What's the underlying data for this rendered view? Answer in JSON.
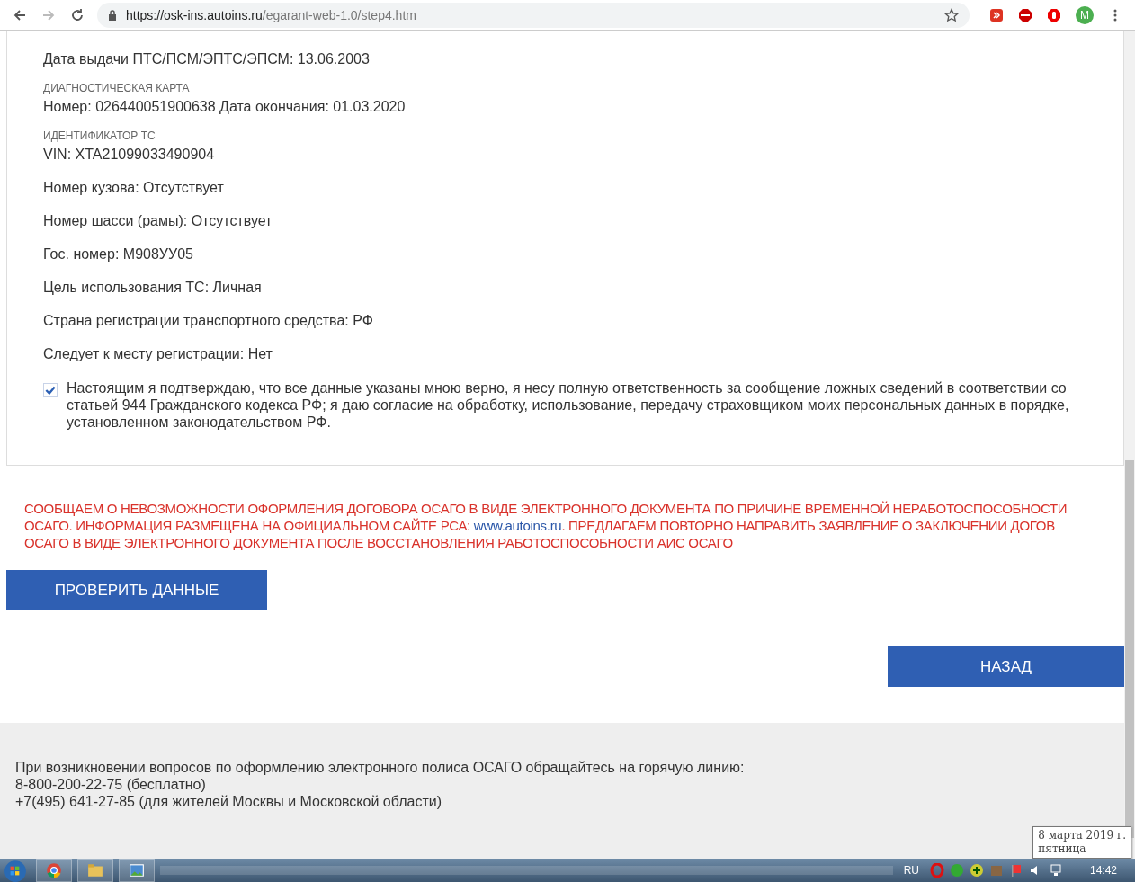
{
  "browser": {
    "url_host": "https://osk-ins.autoins.ru",
    "url_path": "/egarant-web-1.0/step4.htm",
    "profile_initial": "M"
  },
  "fields": [
    {
      "kind": "row",
      "text": "Дата выдачи ПТС/ПСМ/ЭПТС/ЭПСМ: 13.06.2003"
    },
    {
      "kind": "caption",
      "text": "ДИАГНОСТИЧЕСКАЯ КАРТА"
    },
    {
      "kind": "row",
      "text": "Номер: 026440051900638 Дата окончания: 01.03.2020"
    },
    {
      "kind": "caption",
      "text": "ИДЕНТИФИКАТОР ТС"
    },
    {
      "kind": "row",
      "text": "VIN: XTA21099033490904"
    },
    {
      "kind": "row",
      "text": "Номер кузова: Отсутствует"
    },
    {
      "kind": "row",
      "text": "Номер шасси (рамы): Отсутствует"
    },
    {
      "kind": "row",
      "text": "Гос. номер: М908УУ05"
    },
    {
      "kind": "row",
      "text": "Цель использования ТС: Личная"
    },
    {
      "kind": "row",
      "text": "Страна регистрации транспортного средства: РФ"
    },
    {
      "kind": "row",
      "text": "Следует к месту регистрации: Нет"
    }
  ],
  "consent": {
    "checked": true,
    "text": "Настоящим я подтверждаю, что все данные указаны мною верно, я несу полную ответственность за сообщение ложных сведений в соответствии со статьей 944 Гражданского кодекса РФ; я даю согласие на обработку, использование, передачу страховщиком моих персональных данных в порядке, установленном законодательством РФ."
  },
  "notice": {
    "before_link": "СООБЩАЕМ О НЕВОЗМОЖНОСТИ ОФОРМЛЕНИЯ ДОГОВОРА ОСАГО В ВИДЕ ЭЛЕКТРОННОГО ДОКУМЕНТА ПО ПРИЧИНЕ ВРЕМЕННОЙ НЕРАБОТОСПОСОБНОСТИ\nОСАГО. ИНФОРМАЦИЯ РАЗМЕЩЕНА НА ОФИЦИАЛЬНОМ САЙТЕ РСА: ",
    "link": "www.autoins.ru",
    "after_link": ". ПРЕДЛАГАЕМ ПОВТОРНО НАПРАВИТЬ ЗАЯВЛЕНИЕ О ЗАКЛЮЧЕНИИ ДОГОВ\nОСАГО В ВИДЕ ЭЛЕКТРОННОГО ДОКУМЕНТА ПОСЛЕ ВОССТАНОВЛЕНИЯ РАБОТОСПОСОБНОСТИ АИС ОСАГО"
  },
  "check_button": "ПРОВЕРИТЬ ДАННЫЕ",
  "back_button": "НАЗАД",
  "footer": [
    "При возникновении вопросов по оформлению электронного полиса ОСАГО обращайтесь на горячую линию:",
    "8-800-200-22-75 (бесплатно)",
    "+7(495) 641-27-85 (для жителей Москвы и Московской области)"
  ],
  "taskbar": {
    "language": "RU",
    "clock": "14:42",
    "tooltip": [
      "8 марта 2019 г.",
      "пятница"
    ]
  }
}
